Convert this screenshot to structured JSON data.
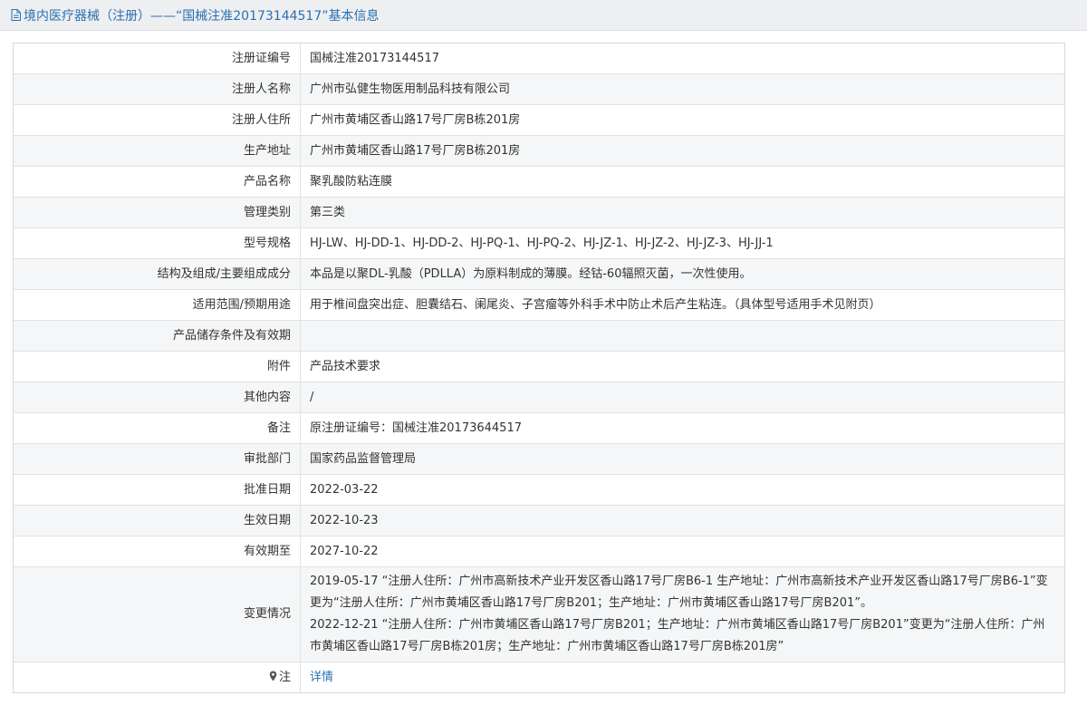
{
  "header": {
    "title": "境内医疗器械（注册）——“国械注准20173144517”基本信息"
  },
  "rows": [
    {
      "label": "注册证编号",
      "value": "国械注准20173144517"
    },
    {
      "label": "注册人名称",
      "value": "广州市弘健生物医用制品科技有限公司"
    },
    {
      "label": "注册人住所",
      "value": "广州市黄埔区香山路17号厂房B栋201房"
    },
    {
      "label": "生产地址",
      "value": "广州市黄埔区香山路17号厂房B栋201房"
    },
    {
      "label": "产品名称",
      "value": "聚乳酸防粘连膜"
    },
    {
      "label": "管理类别",
      "value": "第三类"
    },
    {
      "label": "型号规格",
      "value": "HJ-LW、HJ-DD-1、HJ-DD-2、HJ-PQ-1、HJ-PQ-2、HJ-JZ-1、HJ-JZ-2、HJ-JZ-3、HJ-JJ-1"
    },
    {
      "label": "结构及组成/主要组成成分",
      "value": "本品是以聚DL-乳酸（PDLLA）为原料制成的薄膜。经钴-60辐照灭菌，一次性使用。"
    },
    {
      "label": "适用范围/预期用途",
      "value": "用于椎间盘突出症、胆囊结石、阑尾炎、子宫瘤等外科手术中防止术后产生粘连。（具体型号适用手术见附页）"
    },
    {
      "label": "产品储存条件及有效期",
      "value": ""
    },
    {
      "label": "附件",
      "value": "产品技术要求"
    },
    {
      "label": "其他内容",
      "value": "/"
    },
    {
      "label": "备注",
      "value": "原注册证编号：国械注准20173644517"
    },
    {
      "label": "审批部门",
      "value": "国家药品监督管理局"
    },
    {
      "label": "批准日期",
      "value": "2022-03-22"
    },
    {
      "label": "生效日期",
      "value": "2022-10-23"
    },
    {
      "label": "有效期至",
      "value": "2027-10-22"
    }
  ],
  "changes": {
    "label": "变更情况",
    "lines": [
      "2019-05-17 “注册人住所：广州市高新技术产业开发区香山路17号厂房B6-1 生产地址：广州市高新技术产业开发区香山路17号厂房B6-1”变更为“注册人住所：广州市黄埔区香山路17号厂房B201；生产地址：广州市黄埔区香山路17号厂房B201”。",
      "2022-12-21 “注册人住所：广州市黄埔区香山路17号厂房B201；生产地址：广州市黄埔区香山路17号厂房B201”变更为“注册人住所：广州市黄埔区香山路17号厂房B栋201房；生产地址：广州市黄埔区香山路17号厂房B栋201房”"
    ]
  },
  "note": {
    "label": "注",
    "link_text": "详情"
  },
  "colors": {
    "accent": "#2a6fb3",
    "stripe": "#f5f6f7",
    "border": "#e2e2e2"
  }
}
